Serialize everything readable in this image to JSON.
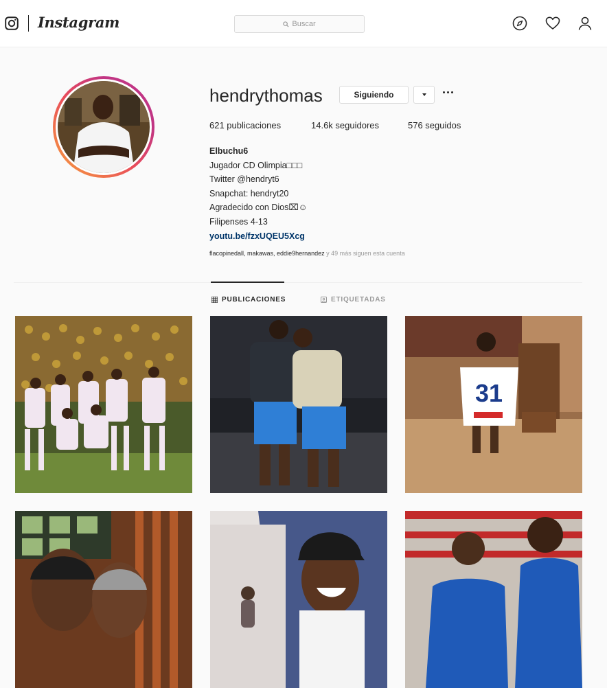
{
  "header": {
    "wordmark": "Instagram",
    "search_placeholder": "Buscar",
    "icons": [
      "instagram-camera-icon",
      "explore-compass-icon",
      "activity-heart-icon",
      "profile-person-icon"
    ]
  },
  "profile": {
    "username": "hendrythomas",
    "follow_button": "Siguiendo",
    "stats": {
      "posts": "621 publicaciones",
      "followers": "14.6k seguidores",
      "following": "576 seguidos"
    },
    "bio": {
      "name": "Elbuchu6",
      "lines": [
        "Jugador CD Olimpia□□□",
        "Twitter @hendryt6",
        "Snapchat: hendryt20",
        "Agradecido con Dios⌧☺",
        "Filipenses 4-13"
      ],
      "link": "youtu.be/fzxUQEU5Xcg"
    },
    "followed_by": {
      "names": "flacopinedall, makawas, eddie9hernandez",
      "suffix": " y 49 más siguen esta cuenta"
    }
  },
  "tabs": [
    {
      "label": "PUBLICACIONES",
      "active": true
    },
    {
      "label": "ETIQUETADAS",
      "active": false
    }
  ],
  "colors": {
    "text": "#262626",
    "muted": "#999999",
    "link": "#003569",
    "border": "#dbdbdb",
    "background": "#fafafa"
  },
  "posts": [
    {
      "index": 1,
      "jersey_number": ""
    },
    {
      "index": 2,
      "jersey_number": ""
    },
    {
      "index": 3,
      "jersey_number": "31"
    },
    {
      "index": 4,
      "jersey_number": ""
    },
    {
      "index": 5,
      "jersey_number": ""
    },
    {
      "index": 6,
      "jersey_number": ""
    }
  ]
}
